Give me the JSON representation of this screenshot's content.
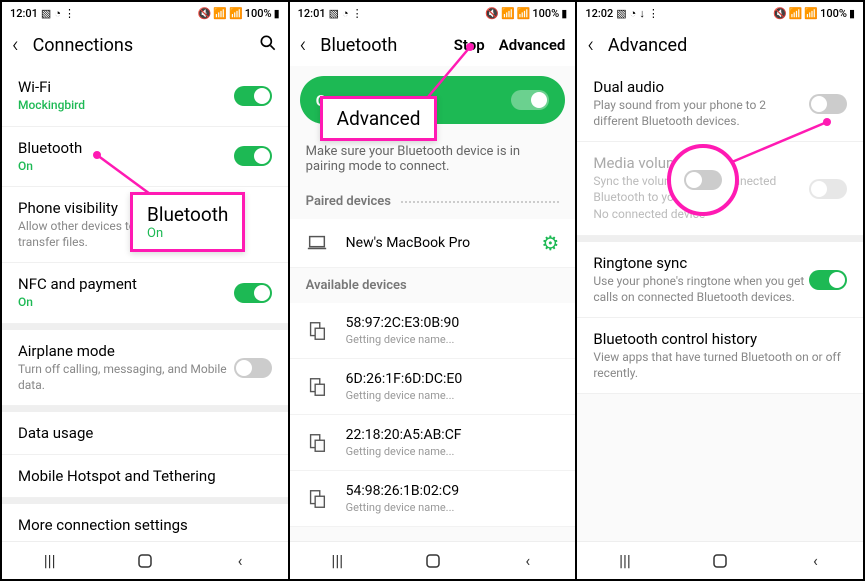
{
  "status": {
    "time1": "12:01",
    "time2": "12:01",
    "time3": "12:02",
    "battery": "100%"
  },
  "phone1": {
    "header": "Connections",
    "wifi": {
      "title": "Wi-Fi",
      "sub": "Mockingbird"
    },
    "bluetooth": {
      "title": "Bluetooth",
      "sub": "On"
    },
    "phoneVis": {
      "title": "Phone visibility",
      "sub": "Allow other devices to find your phone and transfer files."
    },
    "nfc": {
      "title": "NFC and payment",
      "sub": "On"
    },
    "airplane": {
      "title": "Airplane mode",
      "sub": "Turn off calling, messaging, and Mobile data."
    },
    "dataUsage": "Data usage",
    "hotspot": "Mobile Hotspot and Tethering",
    "more": "More connection settings"
  },
  "callout1": {
    "title": "Bluetooth",
    "sub": "On"
  },
  "phone2": {
    "header": "Bluetooth",
    "stop": "Stop",
    "advanced": "Advanced",
    "pillLabel": "On",
    "hint": "Make sure your Bluetooth device is in pairing mode to connect.",
    "pairedLabel": "Paired devices",
    "paired": [
      {
        "name": "New's MacBook Pro"
      }
    ],
    "availLabel": "Available devices",
    "available": [
      {
        "mac": "58:97:2C:E3:0B:90",
        "sub": "Getting device name..."
      },
      {
        "mac": "6D:26:1F:6D:DC:E0",
        "sub": "Getting device name..."
      },
      {
        "mac": "22:18:20:A5:AB:CF",
        "sub": "Getting device name..."
      },
      {
        "mac": "54:98:26:1B:02:C9",
        "sub": "Getting device name..."
      }
    ]
  },
  "callout2": {
    "title": "Advanced"
  },
  "phone3": {
    "header": "Advanced",
    "dualAudio": {
      "title": "Dual audio",
      "sub": "Play sound from your phone to 2 different Bluetooth devices."
    },
    "mediaVol": {
      "title": "Media volume sync",
      "sub": "Sync the volume on the connected Bluetooth to your phone",
      "sub2": "No connected device"
    },
    "ringtone": {
      "title": "Ringtone sync",
      "sub": "Use your phone's ringtone when you get calls on connected Bluetooth devices."
    },
    "history": {
      "title": "Bluetooth control history",
      "sub": "View apps that have turned Bluetooth on or off recently."
    }
  }
}
